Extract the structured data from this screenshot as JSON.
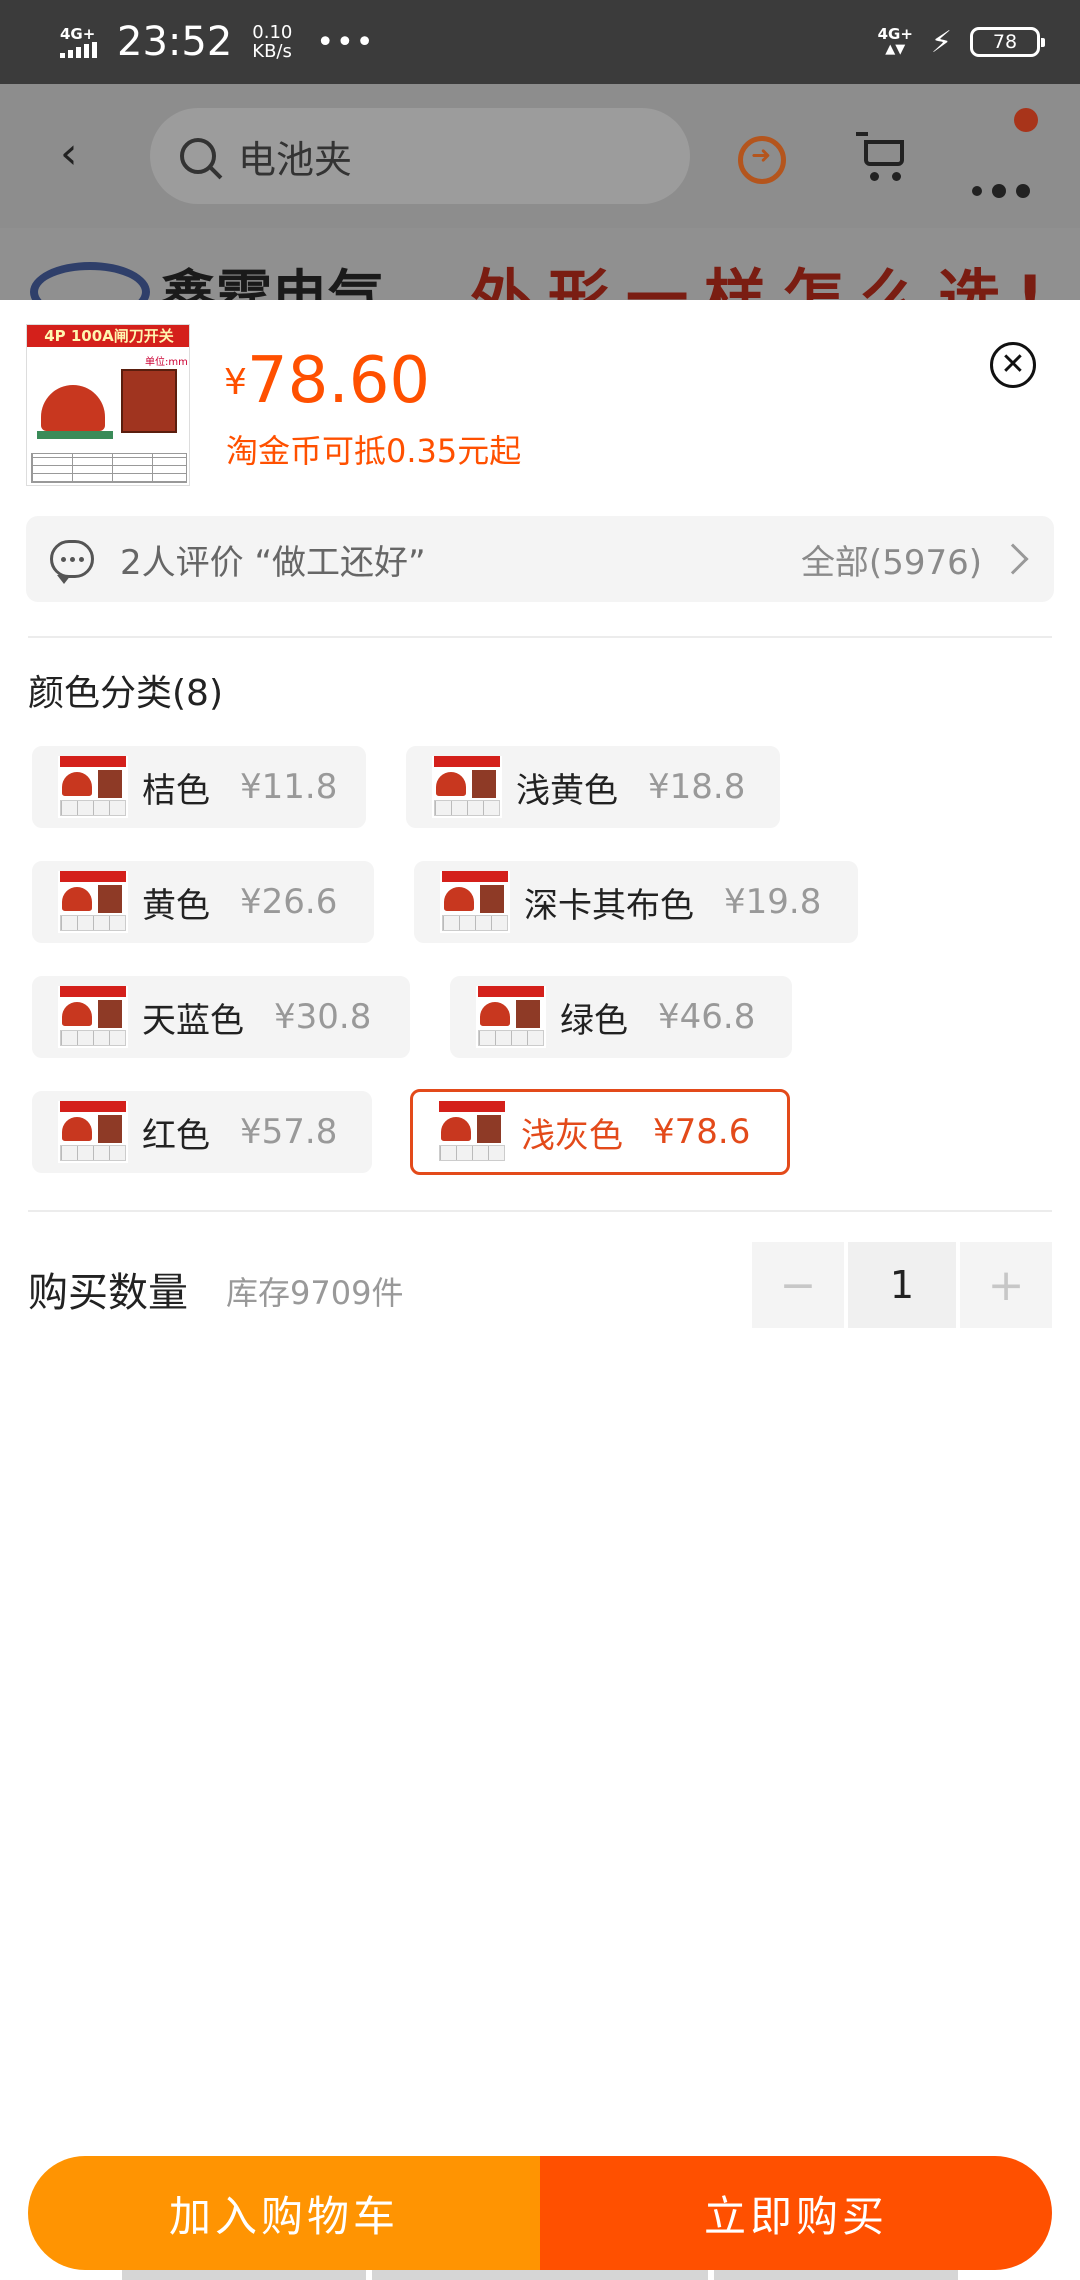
{
  "status_bar": {
    "network_left": "4G+",
    "time": "23:52",
    "speed_value": "0.10",
    "speed_unit": "KB/s",
    "more": "•••",
    "network_right": "4G+",
    "battery": "78"
  },
  "background_page": {
    "search_placeholder": "电池夹",
    "brand_text": "鑫霆电气",
    "slogan_text": "外形一样怎么选!"
  },
  "product": {
    "thumb_tag": "4P 100A闸刀开关",
    "thumb_unit": "单位:mm",
    "currency": "¥",
    "price": "78.60",
    "coin_note": "淘金币可抵0.35元起"
  },
  "review": {
    "text": "2人评价 “做工还好”",
    "all_label": "全部(5976)"
  },
  "colors_section": {
    "title": "颜色分类(8)",
    "options": [
      {
        "name": "桔色",
        "price": "¥11.8",
        "selected": false
      },
      {
        "name": "浅黄色",
        "price": "¥18.8",
        "selected": false
      },
      {
        "name": "黄色",
        "price": "¥26.6",
        "selected": false
      },
      {
        "name": "深卡其布色",
        "price": "¥19.8",
        "selected": false
      },
      {
        "name": "天蓝色",
        "price": "¥30.8",
        "selected": false
      },
      {
        "name": "绿色",
        "price": "¥46.8",
        "selected": false
      },
      {
        "name": "红色",
        "price": "¥57.8",
        "selected": false
      },
      {
        "name": "浅灰色",
        "price": "¥78.6",
        "selected": true
      }
    ]
  },
  "quantity": {
    "label": "购买数量",
    "stock": "库存9709件",
    "minus": "−",
    "value": "1",
    "plus": "+"
  },
  "actions": {
    "add_to_cart": "加入购物车",
    "buy_now": "立即购买"
  },
  "theme": {
    "accent": "#ff5000",
    "cart_button": "#ff9402",
    "selected_border": "#e34a1a"
  }
}
